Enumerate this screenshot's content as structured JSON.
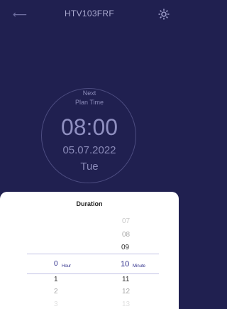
{
  "header": {
    "back_icon": "arrow-left-icon",
    "title": "HTV103FRF",
    "settings_icon": "gear-icon"
  },
  "plan": {
    "line1": "Next",
    "line2": "Plan Time",
    "time": "08:00",
    "date": "05.07.2022",
    "day": "Tue"
  },
  "sheet": {
    "title": "Duration",
    "hour": {
      "selected": "0",
      "unit": "Hour",
      "after": [
        "1",
        "2",
        "3"
      ]
    },
    "minute": {
      "before": [
        "07",
        "08",
        "09"
      ],
      "selected": "10",
      "unit": "Minute",
      "after": [
        "11",
        "12",
        "13"
      ]
    }
  },
  "colors": {
    "background": "#202050",
    "accent": "#2e2e8a"
  }
}
